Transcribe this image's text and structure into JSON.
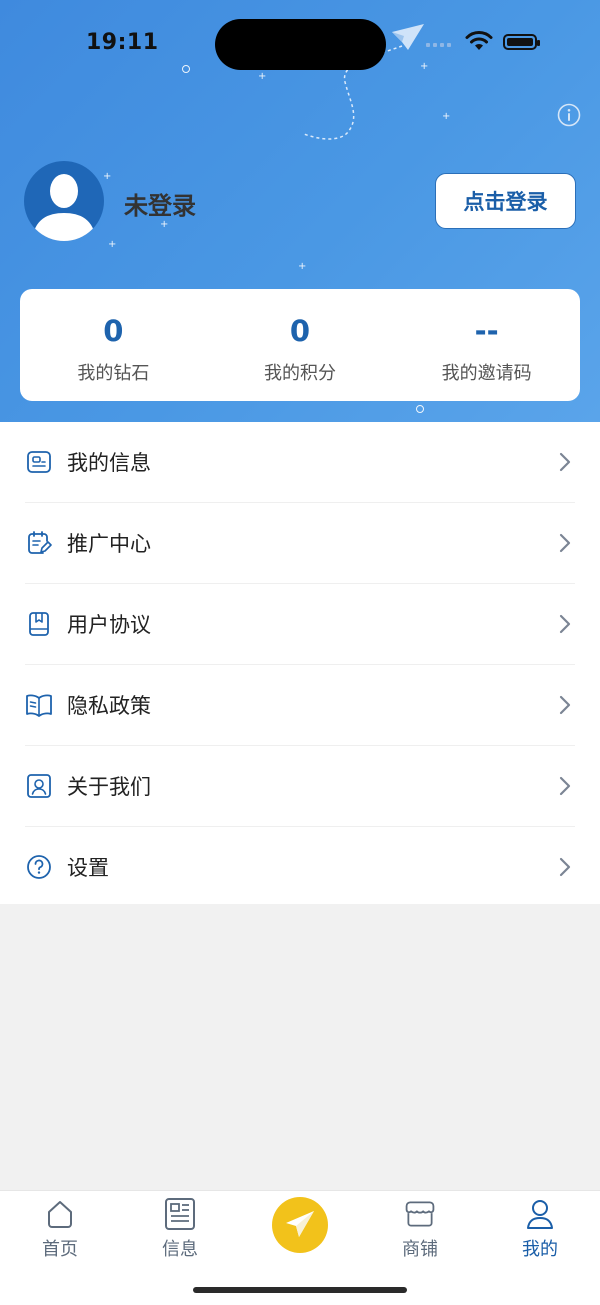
{
  "status_bar": {
    "time": "19:11"
  },
  "profile": {
    "username": "未登录",
    "login_label": "点击登录"
  },
  "stats": [
    {
      "value": "0",
      "label": "我的钻石"
    },
    {
      "value": "0",
      "label": "我的积分"
    },
    {
      "value": "--",
      "label": "我的邀请码"
    }
  ],
  "menu": [
    {
      "label": "我的信息",
      "icon": "id-card-icon"
    },
    {
      "label": "推广中心",
      "icon": "clipboard-edit-icon"
    },
    {
      "label": "用户协议",
      "icon": "bookmark-book-icon"
    },
    {
      "label": "隐私政策",
      "icon": "open-book-icon"
    },
    {
      "label": "关于我们",
      "icon": "contact-icon"
    },
    {
      "label": "设置",
      "icon": "question-circle-icon"
    }
  ],
  "tabbar": [
    {
      "label": "首页",
      "icon": "home-icon",
      "active": false
    },
    {
      "label": "信息",
      "icon": "newspaper-icon",
      "active": false
    },
    {
      "label": "",
      "icon": "paper-plane-icon",
      "active": false
    },
    {
      "label": "商铺",
      "icon": "store-icon",
      "active": false
    },
    {
      "label": "我的",
      "icon": "user-icon",
      "active": true
    }
  ],
  "colors": {
    "primary": "#1e63ad",
    "hero_gradient_start": "#3f8ade",
    "hero_gradient_end": "#5aa4ea",
    "accent_yellow": "#f2c21b",
    "chevron": "#7b8594"
  }
}
